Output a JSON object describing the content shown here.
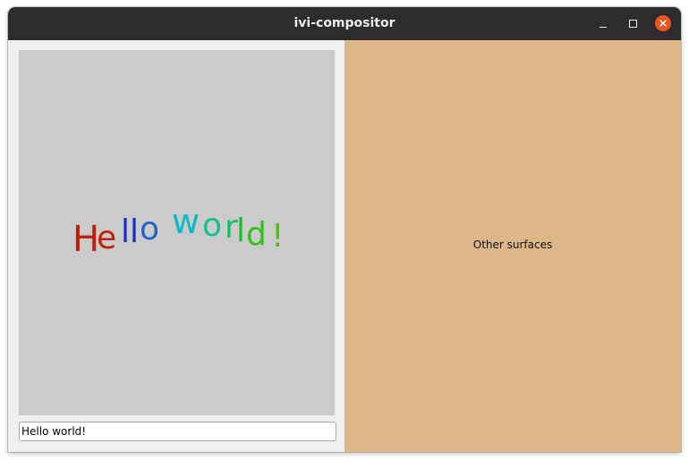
{
  "window": {
    "title": "ivi-compositor",
    "controls": {
      "minimize_icon": "minimize-icon",
      "maximize_icon": "maximize-icon",
      "close_icon": "close-icon",
      "close_color": "#e95420"
    }
  },
  "left_surface": {
    "text": "Hello world!",
    "canvas_color": "#cbcbcb",
    "letter_colors": [
      "#c0200a",
      "#c0200a",
      "#1a2ec8",
      "#1a2ec8",
      "#2266cc",
      "",
      "#12b8c0",
      "#12c090",
      "#12c060",
      "#18c028",
      "#30c018",
      "#50c010"
    ],
    "input": {
      "value": "Hello world!"
    }
  },
  "right_surface": {
    "label": "Other surfaces",
    "background": "#ddb787"
  }
}
